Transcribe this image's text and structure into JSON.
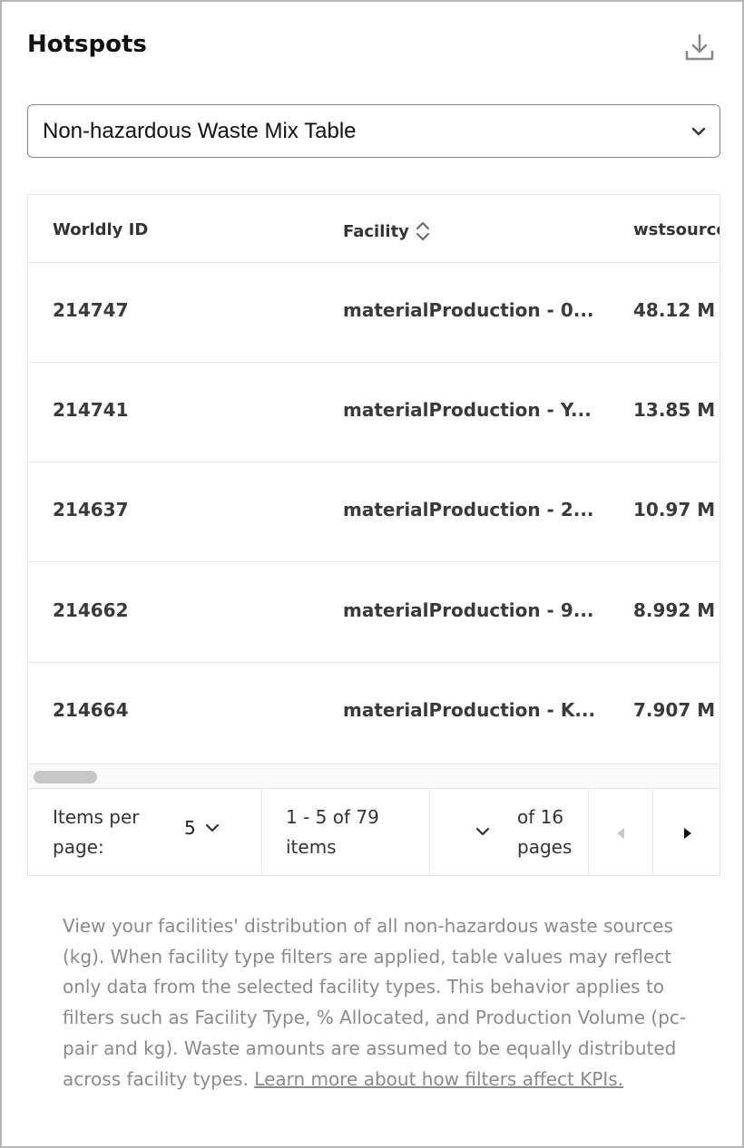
{
  "header": {
    "title": "Hotspots",
    "download_icon": "download-icon"
  },
  "dropdown": {
    "selected": "Non-hazardous Waste Mix Table",
    "icon": "chevron-down-icon"
  },
  "table": {
    "columns": [
      "Worldly ID",
      "Facility",
      "wstsource"
    ],
    "sort_icon": "sort-updown-icon",
    "rows": [
      {
        "id": "214747",
        "facility": "materialProduction - 0...",
        "value": "48.12 M"
      },
      {
        "id": "214741",
        "facility": "materialProduction - Y...",
        "value": "13.85 M"
      },
      {
        "id": "214637",
        "facility": "materialProduction - 2...",
        "value": "10.97 M"
      },
      {
        "id": "214662",
        "facility": "materialProduction - 9...",
        "value": "8.992 M"
      },
      {
        "id": "214664",
        "facility": "materialProduction - K...",
        "value": "7.907 M"
      }
    ]
  },
  "pagination": {
    "items_per_page_label": "Items per page:",
    "items_per_page": "5",
    "range_text": "1 - 5 of 79 items",
    "pages_text": "of 16 pages",
    "prev_icon": "triangle-left-icon",
    "next_icon": "triangle-right-icon"
  },
  "description": {
    "text": "View your facilities' distribution of all non-hazardous waste sources (kg). When facility type filters are applied, table values may reflect only data from the selected facility types. This behavior applies to filters such as Facility Type, % Allocated, and Production Volume (pc-pair and kg). Waste amounts are assumed to be equally distributed across facility types. ",
    "link": "Learn more about how filters affect KPIs."
  },
  "colors": {
    "border": "#b5b5b5",
    "text_dark": "#111111",
    "text_muted": "#8a8a8a"
  }
}
